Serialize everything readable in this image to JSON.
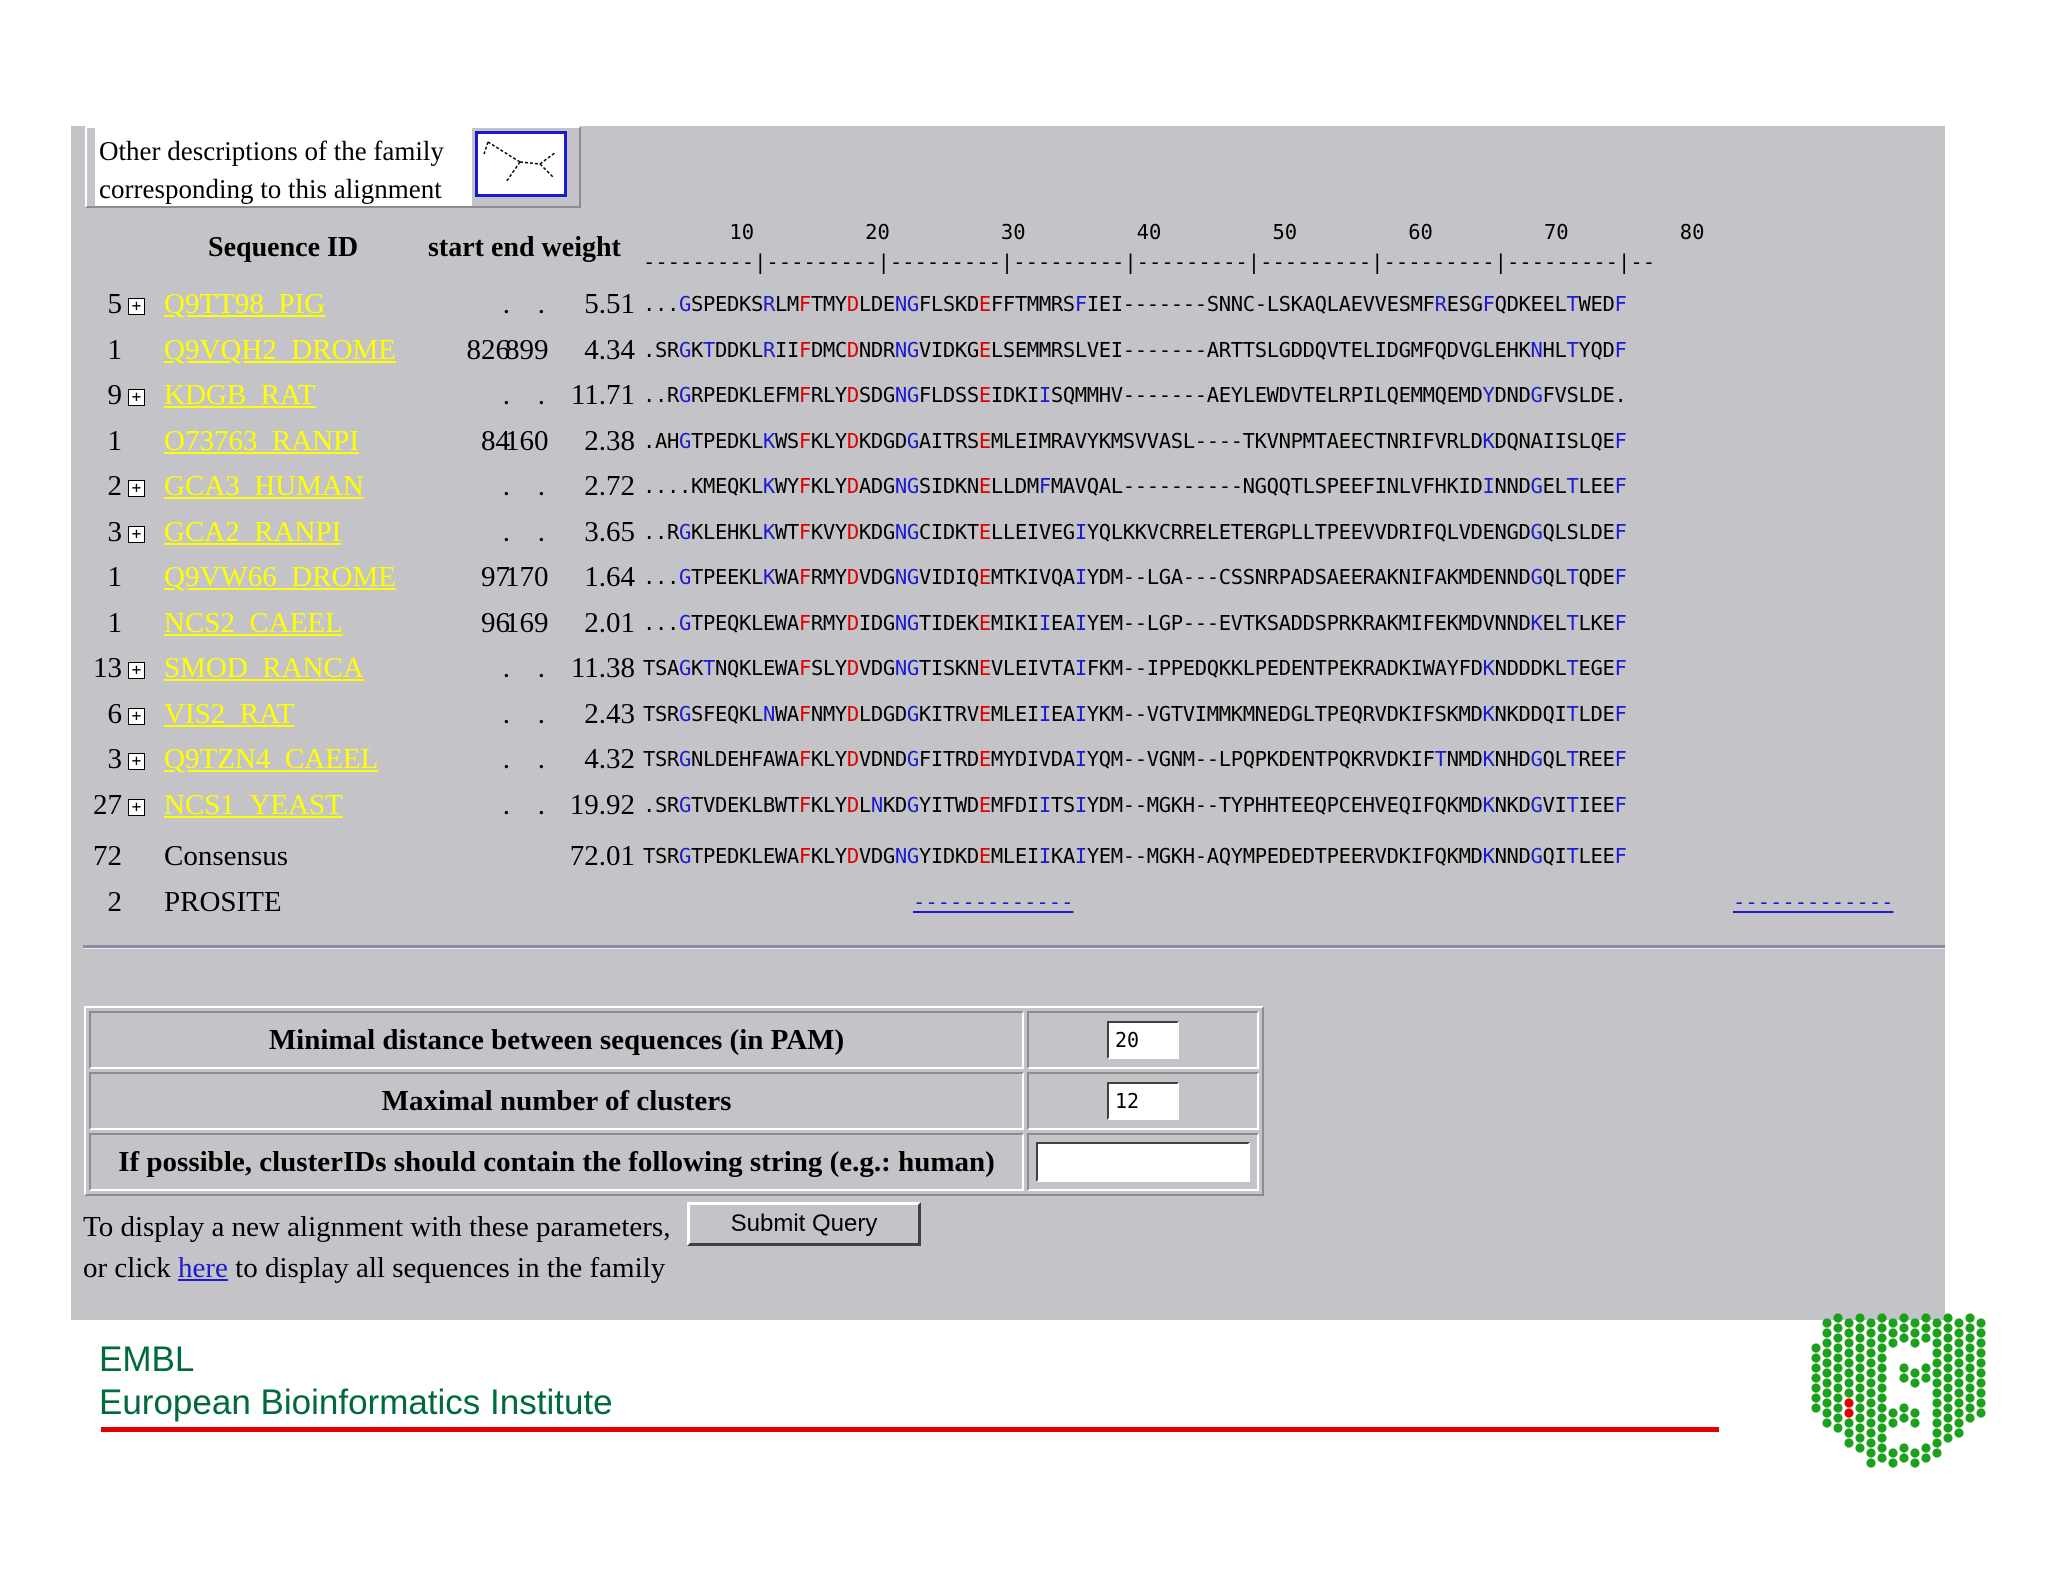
{
  "family_box": {
    "line1": "Other descriptions of the family",
    "line2": "corresponding to this alignment"
  },
  "table_headers": {
    "sequence_id": "Sequence ID",
    "start_end_weight": "start end weight"
  },
  "ruler": {
    "ticks": "       10         20         30         40         50         60         70         80",
    "dashes": "---------|---------|---------|---------|---------|---------|---------|---------|--"
  },
  "rows": [
    {
      "count": "5",
      "expand": "⊞",
      "id": "Q9TT98_PIG",
      "start": ".",
      "end": ".",
      "weight": "5.51",
      "seq": "...GSPEDKSRLMFTMYDLDENGFLSKDEFFTMMRSFIEI-------SNNC-LSKAQLAEVVESMFRESGFQDKEELTWEDF"
    },
    {
      "count": "1",
      "expand": "",
      "id": "Q9VQH2_DROME",
      "start": "826",
      "end": "899",
      "weight": "4.34",
      "seq": ".SRGKTDDKLRIIFDMCDNDRNGVIDKGELSEMMRSLVEI-------ARTTSLGDDQVTELIDGMFQDVGLEHKNHLTYQDF"
    },
    {
      "count": "9",
      "expand": "⊞",
      "id": "KDGB_RAT",
      "start": ".",
      "end": ".",
      "weight": "11.71",
      "seq": "..RGRPEDKLEFMFRLYDSDGNGFLDSSEIDKIISQMMHV-------AEYLEWDVTELRPILQEMMQEMDYDNDGFVSLDE."
    },
    {
      "count": "1",
      "expand": "",
      "id": "O73763_RANPI",
      "start": "84",
      "end": "160",
      "weight": "2.38",
      "seq": ".AHGTPEDKLKWSFKLYDKDGDGAITRSEMLEIMRAVYKMSVVASL----TKVNPMTAEECTNRIFVRLDKDQNAIISLQEF"
    },
    {
      "count": "2",
      "expand": "⊞",
      "id": "GCA3_HUMAN",
      "start": ".",
      "end": ".",
      "weight": "2.72",
      "seq": "....KMEQKLKWYFKLYDADGNGSIDKNELLDMFMAVQAL----------NGQQTLSPEEFINLVFHKIDINNDGELTLEEF"
    },
    {
      "count": "3",
      "expand": "⊞",
      "id": "GCA2_RANPI",
      "start": ".",
      "end": ".",
      "weight": "3.65",
      "seq": "..RGKLEHKLKWTFKVYDKDGNGCIDKTELLEIVEGIYQLKKVCRRELETERGPLLTPEEVVDRIFQLVDENGDGQLSLDEF"
    },
    {
      "count": "1",
      "expand": "",
      "id": "Q9VW66_DROME",
      "start": "97",
      "end": "170",
      "weight": "1.64",
      "seq": "...GTPEEKLKWAFRMYDVDGNGVIDIQEMTKIVQAIYDM--LGA---CSSNRPADSAEERAKNIFAKMDENNDGQLTQDEF"
    },
    {
      "count": "1",
      "expand": "",
      "id": "NCS2_CAEEL",
      "start": "96",
      "end": "169",
      "weight": "2.01",
      "seq": "...GTPEQKLEWAFRMYDIDGNGTIDEKEMIKIIEAIYEM--LGP---EVTKSADDSPRKRAKMIFEKMDVNNDKELTLKEF"
    },
    {
      "count": "13",
      "expand": "⊞",
      "id": "SMOD_RANCA",
      "start": ".",
      "end": ".",
      "weight": "11.38",
      "seq": "TSAGKTNQKLEWAFSLYDVDGNGTISKNEVLEIVTAIFKM--IPPEDQKKLPEDENTPEKRADKIWAYFDKNDDDKLTEGEF"
    },
    {
      "count": "6",
      "expand": "⊞",
      "id": "VIS2_RAT",
      "start": ".",
      "end": ".",
      "weight": "2.43",
      "seq": "TSRGSFEQKLNWAFNMYDLDGDGKITRVEMLEIIEAIYKM--VGTVIMMKMNEDGLTPEQRVDKIFSKMDKNKDDQITLDEF"
    },
    {
      "count": "3",
      "expand": "⊞",
      "id": "Q9TZN4_CAEEL",
      "start": ".",
      "end": ".",
      "weight": "4.32",
      "seq": "TSRGNLDEHFAWAFKLYDVDNDGFITRDEMYDIVDAIYQM--VGNM--LPQPKDENTPQKRVDKIFTNMDKNHDGQLTREEF"
    },
    {
      "count": "27",
      "expand": "⊞",
      "id": "NCS1_YEAST",
      "start": ".",
      "end": ".",
      "weight": "19.92",
      "seq": ".SRGTVDEKLBWTFKLYDLNKDGYITWDEMFDIITSIYDM--MGKH--TYPHHTEEQPCEHVEQIFQKMDKNKDGVITIEEF"
    }
  ],
  "consensus": {
    "count": "72",
    "label": "Consensus",
    "weight": "72.01",
    "seq": "TSRGTPEDKLEWAFKLYDVDGNGYIDKDEMLEIIKAIYEM--MGKH-AQYMPEDEDTPEERVDKIFQKMDKNNDGQITLEEF"
  },
  "prosite": {
    "count": "2",
    "label": "PROSITE",
    "mark1": "-------------",
    "mark2": "-------------"
  },
  "params": {
    "min_distance_label": "Minimal distance between sequences (in PAM)",
    "min_distance_value": "20",
    "max_clusters_label": "Maximal number of clusters",
    "max_clusters_value": "12",
    "cluster_string_label": "If possible, clusterIDs should contain the following string (e.g.: human)",
    "cluster_string_value": ""
  },
  "footer_form": {
    "line1": "To display a new alignment with these parameters,",
    "submit_label": "Submit Query",
    "line2_prefix": "or click",
    "link_here": "here",
    "line2_suffix": "to display all sequences in the family"
  },
  "branding": {
    "line1": "EMBL",
    "line2": "European Bioinformatics Institute"
  },
  "colors": {
    "panel": "#c4c4c8",
    "id_link": "#ffff00",
    "residue_red": "#e00000",
    "residue_blue": "#1a1ad0",
    "brand_green": "#006a3a",
    "logo_green": "#1aa01a"
  },
  "icons": {
    "tree": "phylogenetic-tree-icon",
    "expand": "plus-box-icon",
    "logo": "ebi-logo"
  }
}
